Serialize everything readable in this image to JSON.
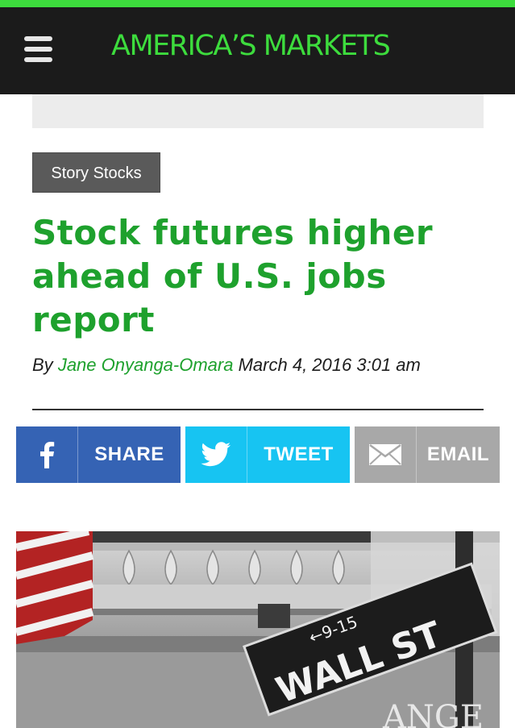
{
  "header": {
    "logo_text": "AMERICA’S MARKETS",
    "menu_icon": "hamburger-menu-icon",
    "accent_color": "#3ddc3d",
    "background_color": "#1b1b1b"
  },
  "article": {
    "category": "Story Stocks",
    "headline": "Stock futures higher ahead of U.S. jobs report",
    "byline_prefix": "By",
    "author": "Jane Onyanga-Omara",
    "date": "March 4, 2016 3:01 am",
    "headline_color": "#1ea12d"
  },
  "share_bar": {
    "buttons": [
      {
        "label": "SHARE",
        "icon": "facebook-icon",
        "color": "#3563b4"
      },
      {
        "label": "TWEET",
        "icon": "twitter-bird-icon",
        "color": "#17c4f2"
      },
      {
        "label": "EMAIL",
        "icon": "envelope-icon",
        "color": "#a8a8a8"
      }
    ]
  },
  "hero_image": {
    "sign_direction": "←9-15",
    "sign_street": "WALL ST",
    "building_text": "ANGE"
  }
}
